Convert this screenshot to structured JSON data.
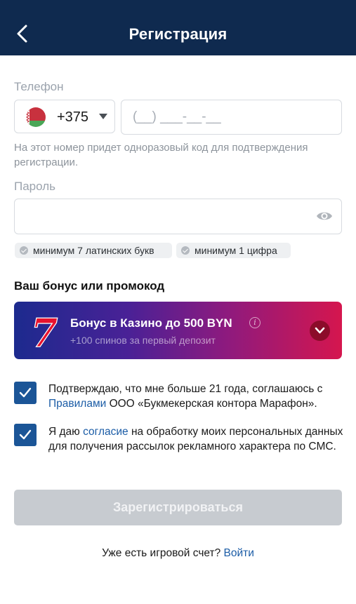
{
  "header": {
    "title": "Регистрация"
  },
  "phone": {
    "label": "Телефон",
    "country_code": "+375",
    "placeholder": "(__) ___-__-__",
    "hint": "На этот номер придет одноразовый код для подтверждения регистрации."
  },
  "password": {
    "label": "Пароль",
    "rules": [
      "минимум 7 латинских букв",
      "минимум 1 цифра"
    ]
  },
  "bonus": {
    "section_title": "Ваш бонус или промокод",
    "title": "Бонус в Казино до 500 BYN",
    "subtitle": "+100 спинов за первый депозит",
    "logo_glyph": "7"
  },
  "consents": [
    {
      "checked": true,
      "text_before": "Подтверждаю, что мне больше 21 года, соглашаюсь с ",
      "link": "Правилами",
      "text_after": " ООО «Букмекерская контора Марафон»."
    },
    {
      "checked": true,
      "text_before": "Я даю ",
      "link": "согласие",
      "text_after": " на обработку моих персональных данных для получения рассылок рекламного характера по СМС."
    }
  ],
  "submit_label": "Зарегистрироваться",
  "login": {
    "prompt": "Уже есть игровой счет?",
    "link": "Войти"
  },
  "colors": {
    "header_bg": "#0f2a4f",
    "accent_blue": "#1b5597",
    "link_blue": "#1b5ca6",
    "button_disabled": "#c7cbd0",
    "bonus_gradient_start": "#1c2a8e",
    "bonus_gradient_end": "#d5164e"
  }
}
